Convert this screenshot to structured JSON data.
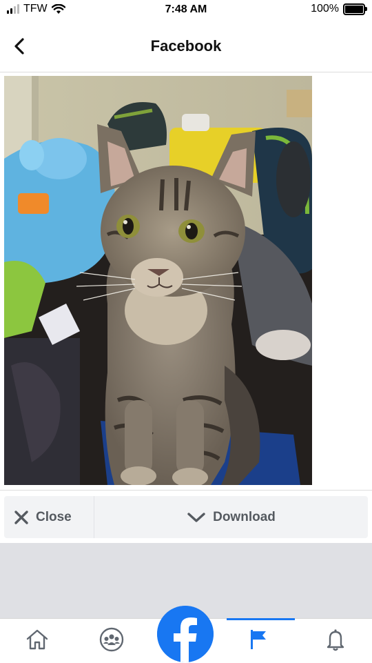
{
  "status_bar": {
    "carrier": "TFW",
    "time": "7:48 AM",
    "battery": "100%"
  },
  "header": {
    "title": "Facebook",
    "back_icon": "chevron-left-icon"
  },
  "photo": {
    "subject": "tabby-cat",
    "icon": "photo"
  },
  "actions": {
    "close_label": "Close",
    "download_label": "Download"
  },
  "tab_bar": {
    "active_index": 3,
    "items": [
      {
        "icon": "home-icon"
      },
      {
        "icon": "groups-icon"
      },
      {
        "icon": "facebook-logo-icon"
      },
      {
        "icon": "pages-flag-icon"
      },
      {
        "icon": "bell-icon"
      }
    ],
    "accent": "#1877f2"
  }
}
